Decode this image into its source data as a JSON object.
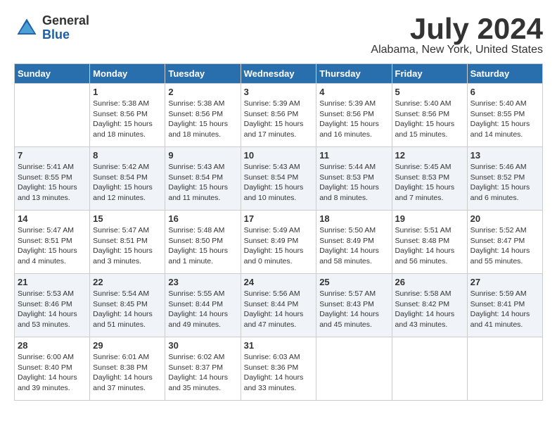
{
  "logo": {
    "general": "General",
    "blue": "Blue"
  },
  "title": {
    "month_year": "July 2024",
    "location": "Alabama, New York, United States"
  },
  "days_of_week": [
    "Sunday",
    "Monday",
    "Tuesday",
    "Wednesday",
    "Thursday",
    "Friday",
    "Saturday"
  ],
  "weeks": [
    [
      {
        "day": "",
        "detail": ""
      },
      {
        "day": "1",
        "detail": "Sunrise: 5:38 AM\nSunset: 8:56 PM\nDaylight: 15 hours\nand 18 minutes."
      },
      {
        "day": "2",
        "detail": "Sunrise: 5:38 AM\nSunset: 8:56 PM\nDaylight: 15 hours\nand 18 minutes."
      },
      {
        "day": "3",
        "detail": "Sunrise: 5:39 AM\nSunset: 8:56 PM\nDaylight: 15 hours\nand 17 minutes."
      },
      {
        "day": "4",
        "detail": "Sunrise: 5:39 AM\nSunset: 8:56 PM\nDaylight: 15 hours\nand 16 minutes."
      },
      {
        "day": "5",
        "detail": "Sunrise: 5:40 AM\nSunset: 8:56 PM\nDaylight: 15 hours\nand 15 minutes."
      },
      {
        "day": "6",
        "detail": "Sunrise: 5:40 AM\nSunset: 8:55 PM\nDaylight: 15 hours\nand 14 minutes."
      }
    ],
    [
      {
        "day": "7",
        "detail": "Sunrise: 5:41 AM\nSunset: 8:55 PM\nDaylight: 15 hours\nand 13 minutes."
      },
      {
        "day": "8",
        "detail": "Sunrise: 5:42 AM\nSunset: 8:54 PM\nDaylight: 15 hours\nand 12 minutes."
      },
      {
        "day": "9",
        "detail": "Sunrise: 5:43 AM\nSunset: 8:54 PM\nDaylight: 15 hours\nand 11 minutes."
      },
      {
        "day": "10",
        "detail": "Sunrise: 5:43 AM\nSunset: 8:54 PM\nDaylight: 15 hours\nand 10 minutes."
      },
      {
        "day": "11",
        "detail": "Sunrise: 5:44 AM\nSunset: 8:53 PM\nDaylight: 15 hours\nand 8 minutes."
      },
      {
        "day": "12",
        "detail": "Sunrise: 5:45 AM\nSunset: 8:53 PM\nDaylight: 15 hours\nand 7 minutes."
      },
      {
        "day": "13",
        "detail": "Sunrise: 5:46 AM\nSunset: 8:52 PM\nDaylight: 15 hours\nand 6 minutes."
      }
    ],
    [
      {
        "day": "14",
        "detail": "Sunrise: 5:47 AM\nSunset: 8:51 PM\nDaylight: 15 hours\nand 4 minutes."
      },
      {
        "day": "15",
        "detail": "Sunrise: 5:47 AM\nSunset: 8:51 PM\nDaylight: 15 hours\nand 3 minutes."
      },
      {
        "day": "16",
        "detail": "Sunrise: 5:48 AM\nSunset: 8:50 PM\nDaylight: 15 hours\nand 1 minute."
      },
      {
        "day": "17",
        "detail": "Sunrise: 5:49 AM\nSunset: 8:49 PM\nDaylight: 15 hours\nand 0 minutes."
      },
      {
        "day": "18",
        "detail": "Sunrise: 5:50 AM\nSunset: 8:49 PM\nDaylight: 14 hours\nand 58 minutes."
      },
      {
        "day": "19",
        "detail": "Sunrise: 5:51 AM\nSunset: 8:48 PM\nDaylight: 14 hours\nand 56 minutes."
      },
      {
        "day": "20",
        "detail": "Sunrise: 5:52 AM\nSunset: 8:47 PM\nDaylight: 14 hours\nand 55 minutes."
      }
    ],
    [
      {
        "day": "21",
        "detail": "Sunrise: 5:53 AM\nSunset: 8:46 PM\nDaylight: 14 hours\nand 53 minutes."
      },
      {
        "day": "22",
        "detail": "Sunrise: 5:54 AM\nSunset: 8:45 PM\nDaylight: 14 hours\nand 51 minutes."
      },
      {
        "day": "23",
        "detail": "Sunrise: 5:55 AM\nSunset: 8:44 PM\nDaylight: 14 hours\nand 49 minutes."
      },
      {
        "day": "24",
        "detail": "Sunrise: 5:56 AM\nSunset: 8:44 PM\nDaylight: 14 hours\nand 47 minutes."
      },
      {
        "day": "25",
        "detail": "Sunrise: 5:57 AM\nSunset: 8:43 PM\nDaylight: 14 hours\nand 45 minutes."
      },
      {
        "day": "26",
        "detail": "Sunrise: 5:58 AM\nSunset: 8:42 PM\nDaylight: 14 hours\nand 43 minutes."
      },
      {
        "day": "27",
        "detail": "Sunrise: 5:59 AM\nSunset: 8:41 PM\nDaylight: 14 hours\nand 41 minutes."
      }
    ],
    [
      {
        "day": "28",
        "detail": "Sunrise: 6:00 AM\nSunset: 8:40 PM\nDaylight: 14 hours\nand 39 minutes."
      },
      {
        "day": "29",
        "detail": "Sunrise: 6:01 AM\nSunset: 8:38 PM\nDaylight: 14 hours\nand 37 minutes."
      },
      {
        "day": "30",
        "detail": "Sunrise: 6:02 AM\nSunset: 8:37 PM\nDaylight: 14 hours\nand 35 minutes."
      },
      {
        "day": "31",
        "detail": "Sunrise: 6:03 AM\nSunset: 8:36 PM\nDaylight: 14 hours\nand 33 minutes."
      },
      {
        "day": "",
        "detail": ""
      },
      {
        "day": "",
        "detail": ""
      },
      {
        "day": "",
        "detail": ""
      }
    ]
  ]
}
